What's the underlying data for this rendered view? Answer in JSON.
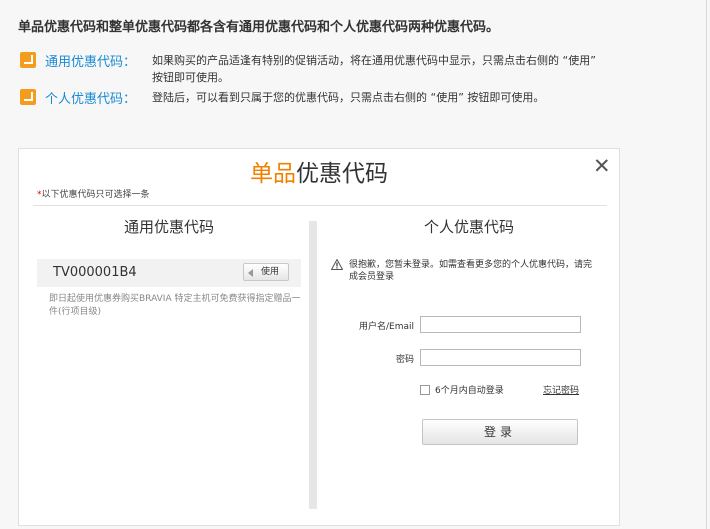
{
  "intro": {
    "title": "单品优惠代码和整单优惠代码都各含有通用优惠代码和个人优惠代码两种优惠代码。",
    "items": [
      {
        "label": "通用优惠代码：",
        "text": "如果购买的产品适逢有特别的促销活动，将在通用优惠代码中显示，只需点击右侧的 “使用” 按钮即可使用。"
      },
      {
        "label": "个人优惠代码：",
        "text": "登陆后，可以看到只属于您的优惠代码，只需点击右侧的 “使用” 按钮即可使用。"
      }
    ]
  },
  "modal": {
    "title_highlight": "单品",
    "title_rest": "优惠代码",
    "close": "✕",
    "note_star": "*",
    "note": "以下优惠代码只可选择一条",
    "left": {
      "title": "通用优惠代码",
      "coupon_code": "TV000001B4",
      "use_label": "使用",
      "coupon_desc": "即日起使用优惠券购买BRAVIA 特定主机可免费获得指定赠品一件(行项目级)"
    },
    "right": {
      "title": "个人优惠代码",
      "warning": "很抱歉，您暂未登录。如需查看更多您的个人优惠代码，请完成会员登录",
      "username_label": "用户名/Email",
      "password_label": "密码",
      "username_value": "",
      "password_value": "",
      "remember_label": "6个月内自动登录",
      "forgot_label": "忘记密码",
      "login_label": "登录"
    }
  },
  "colors": {
    "accent_orange": "#f08200",
    "link_blue": "#1a8ad4",
    "badge_orange": "#f39c1e"
  }
}
